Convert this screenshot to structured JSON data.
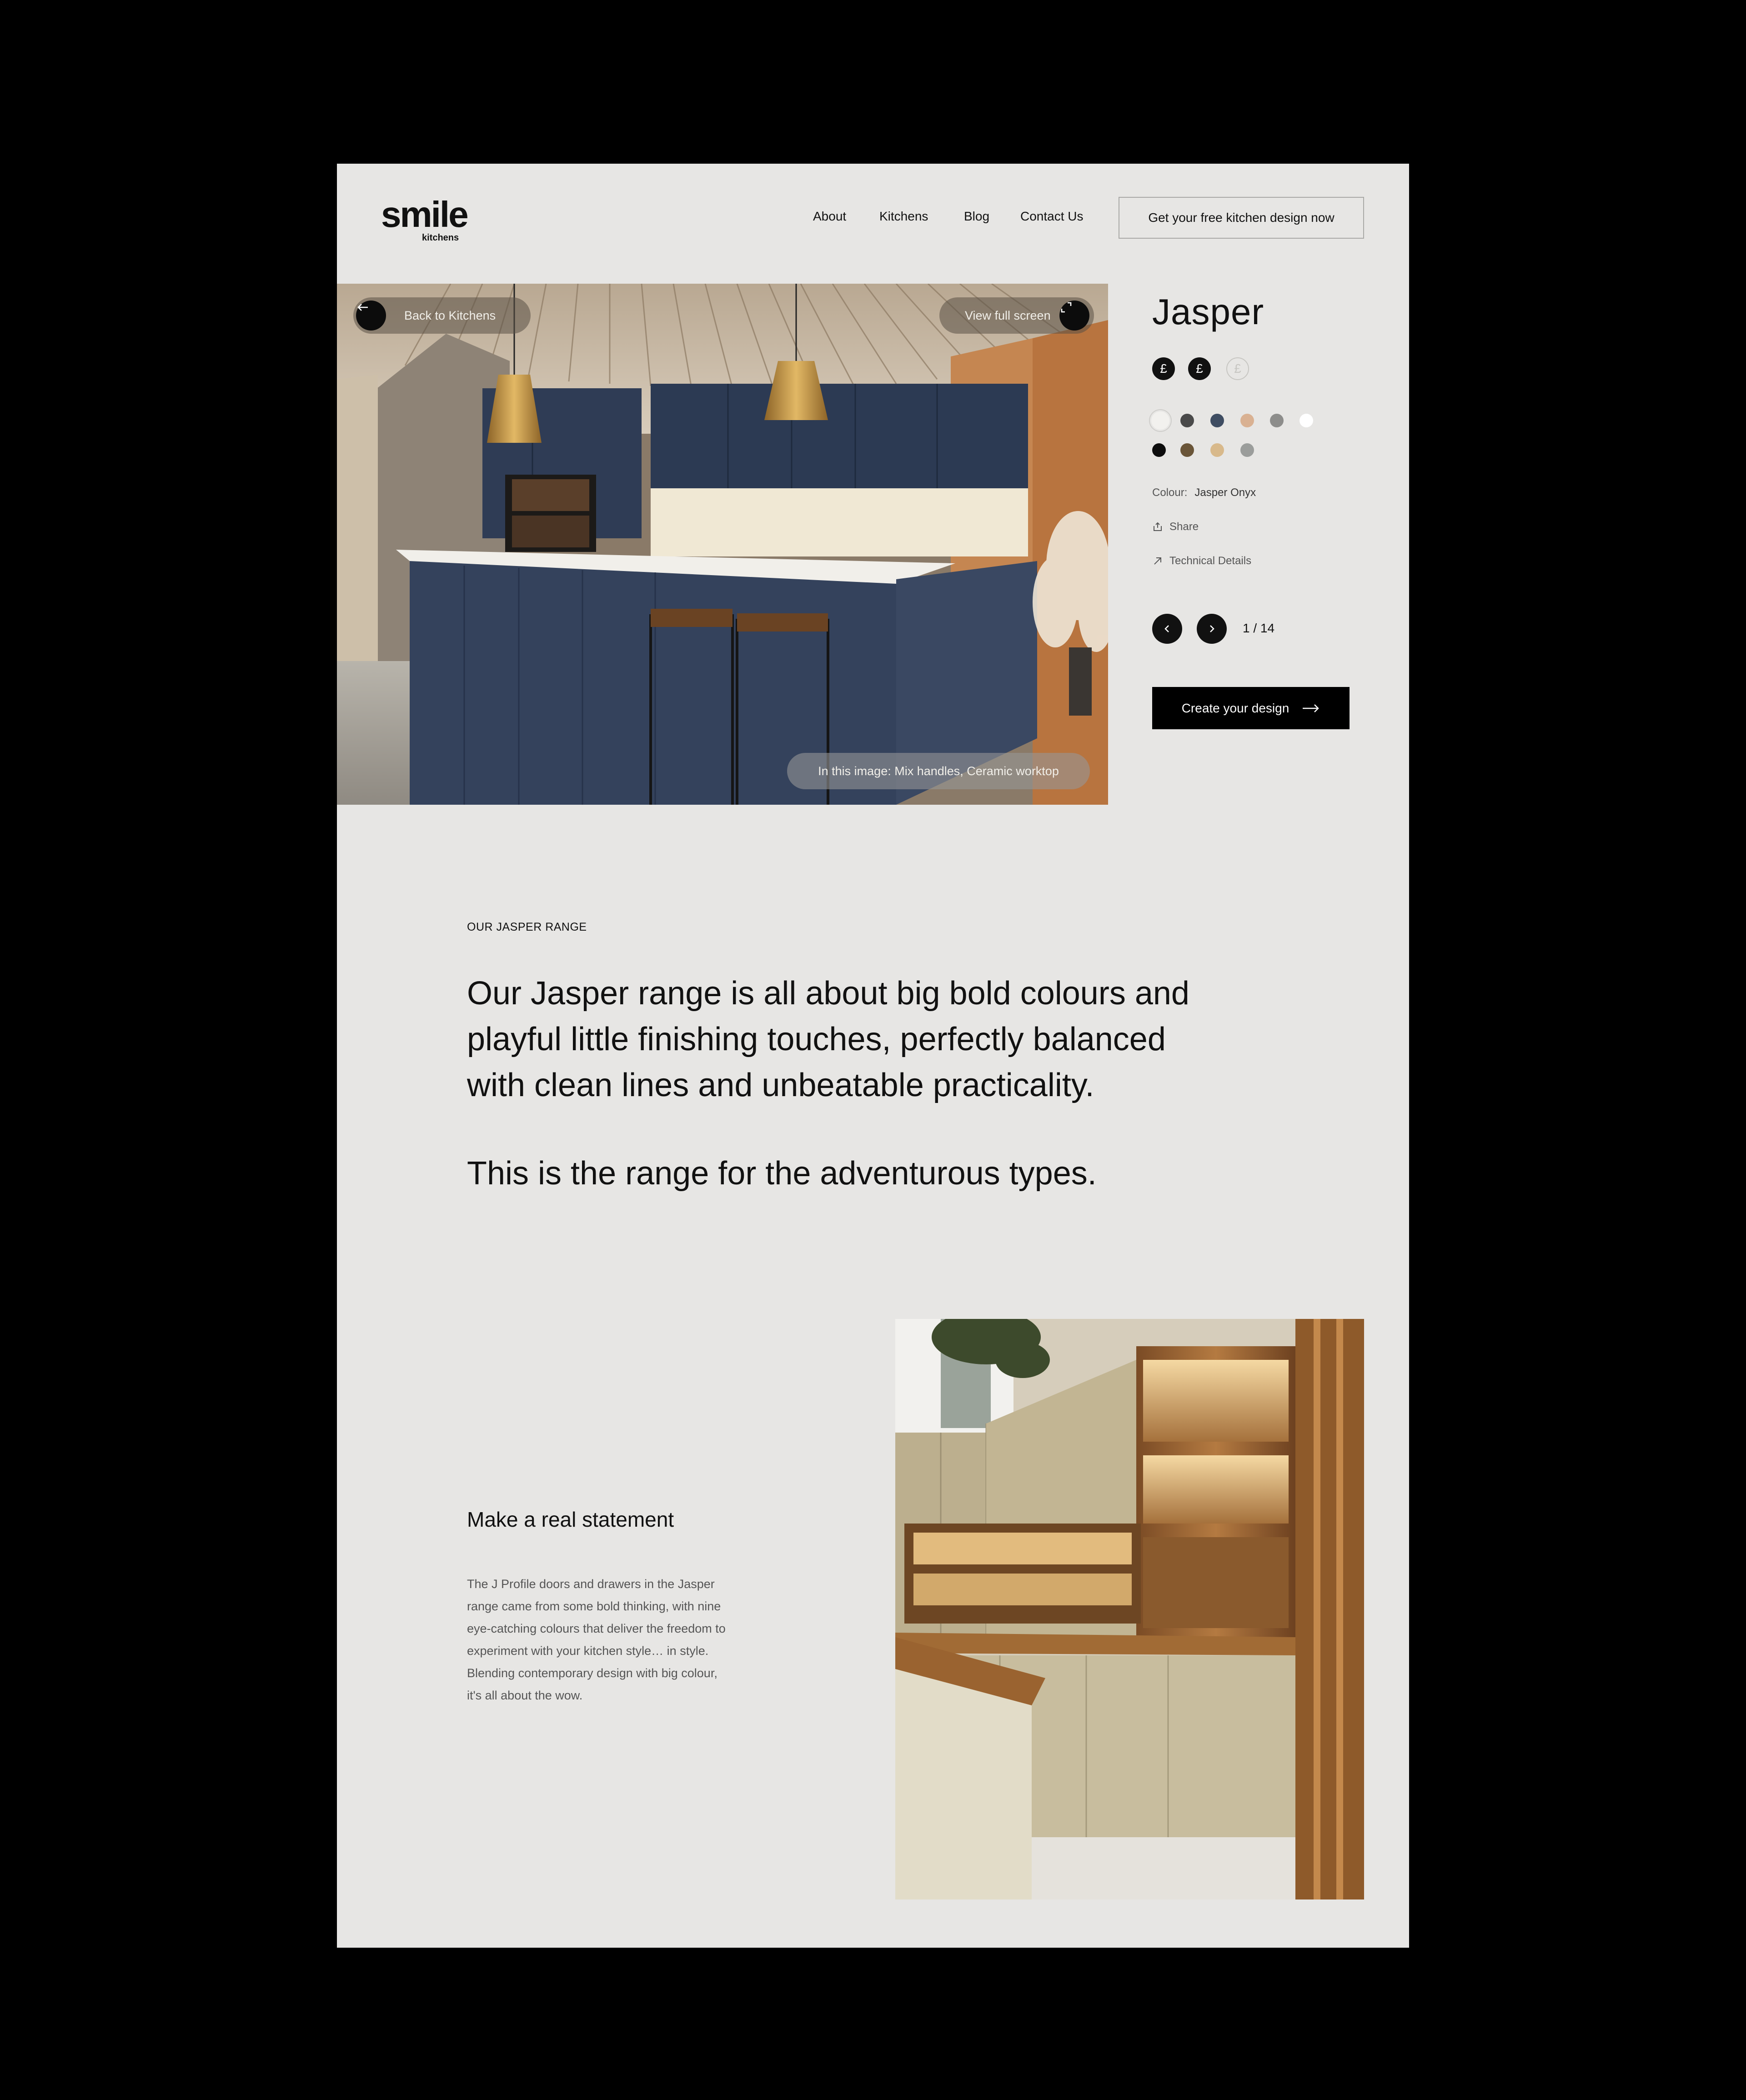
{
  "header": {
    "logo_text": "smile",
    "logo_sub": "kitchens",
    "nav": [
      "About",
      "Kitchens",
      "Blog",
      "Contact Us"
    ],
    "cta": "Get your free kitchen design now"
  },
  "hero": {
    "back_label": "Back to Kitchens",
    "fullscreen_label": "View full screen",
    "caption": "In this image: Mix handles, Ceramic worktop"
  },
  "product": {
    "title": "Jasper",
    "price_symbols": [
      "£",
      "£",
      "£"
    ],
    "price_active": 2,
    "swatches_row1": [
      "#f2f1ee",
      "#4a4a4a",
      "#3f4d62",
      "#d9b192",
      "#8d8d8b",
      "#ffffff"
    ],
    "swatches_row2": [
      "#0d0d0d",
      "#6a5538",
      "#d8b98b",
      "#9b9d9b"
    ],
    "colour_label": "Colour:",
    "colour_value": "Jasper Onyx",
    "share_label": "Share",
    "tech_label": "Technical Details",
    "pager": "1 / 14",
    "create_label": "Create your design"
  },
  "intro": {
    "eyebrow": "OUR JASPER RANGE",
    "line1": "Our Jasper range is all about big bold colours and",
    "line2": "playful little finishing touches, perfectly balanced",
    "line3": "with clean lines and unbeatable practicality.",
    "line4": "This is the range for the adventurous types."
  },
  "statement": {
    "title": "Make a real statement",
    "body1": "The J Profile doors and drawers in the Jasper",
    "body2": "range came from some bold thinking, with nine",
    "body3": "eye-catching colours that deliver the freedom to",
    "body4": "experiment with your kitchen style… in style.",
    "body5": "Blending contemporary design with big colour,",
    "body6": "it's all about the wow."
  }
}
